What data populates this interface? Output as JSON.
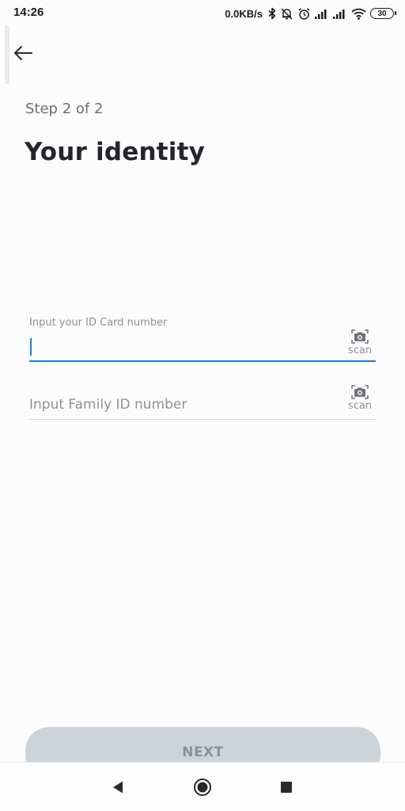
{
  "status_bar": {
    "time": "14:26",
    "net_speed": "0.0KB/s",
    "battery_level": "30",
    "icons": [
      "bluetooth-icon",
      "dnd-bell-off-icon",
      "alarm-icon",
      "signal-icon",
      "signal-icon",
      "wifi-icon",
      "battery-icon"
    ]
  },
  "header": {
    "back_icon": "arrow-left-icon",
    "step": "Step 2 of 2",
    "title": "Your identity"
  },
  "form": {
    "id_card": {
      "label": "Input your ID Card number",
      "value": "",
      "scan_label": "scan",
      "scan_icon": "camera-scan-icon",
      "focused": true
    },
    "family_id": {
      "placeholder": "Input Family ID number",
      "value": "",
      "scan_label": "scan",
      "scan_icon": "camera-scan-icon"
    }
  },
  "actions": {
    "next_label": "NEXT"
  },
  "nav_bar": {
    "icons": [
      "nav-back-icon",
      "nav-home-icon",
      "nav-recents-icon"
    ]
  },
  "colors": {
    "accent": "#1e7bd0",
    "button_bg": "#ccd4db",
    "button_text": "#8a939d",
    "title_text": "#23252b",
    "muted_text": "#8d9096"
  }
}
